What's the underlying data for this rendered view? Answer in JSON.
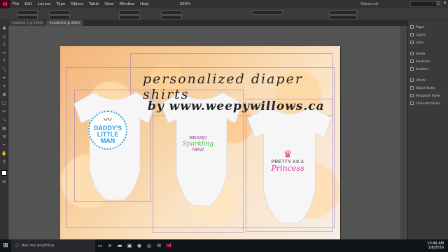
{
  "app": {
    "logo": "Id"
  },
  "menu": [
    "File",
    "Edit",
    "Layout",
    "Type",
    "Object",
    "Table",
    "View",
    "Window",
    "Help"
  ],
  "zoom": "200%",
  "workspace": "Advanced",
  "tabs": [
    {
      "label": "*Untitled-1 @ 200%",
      "active": false
    },
    {
      "label": "*Untitled-2 @ 200%",
      "active": true
    }
  ],
  "document": {
    "title_line1": "personalized  diaper  shirts",
    "title_line2": "by  www.weepywillows.ca",
    "onesie1": {
      "mustache": "🥸",
      "line1": "DADDY'S",
      "line2": "LITTLE",
      "line3": "MAN"
    },
    "onesie2": {
      "line1": "BRAND",
      "line2": "Sparkling",
      "line3": "NEW"
    },
    "onesie3": {
      "line1": "PRETTY AS A",
      "line2": "Princess"
    }
  },
  "panels": [
    "Pages",
    "Layers",
    "Links",
    "Stroke",
    "Swatches",
    "Gradient",
    "Effects",
    "Object Styles",
    "Paragraph Styles",
    "Character Styles"
  ],
  "taskbar": {
    "search_placeholder": "Ask me anything",
    "time": "10:49 AM",
    "date": "1/8/2016"
  },
  "colors": {
    "accent": "#ff3366",
    "blue": "#2aa0d6",
    "pink": "#e0389a",
    "green": "#55b855"
  }
}
